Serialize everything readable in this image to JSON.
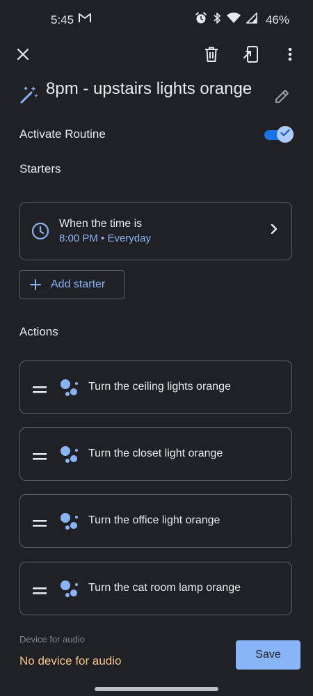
{
  "status_bar": {
    "time": "5:45",
    "battery": "46%",
    "icons": [
      "gmail-icon",
      "alarm-icon",
      "bluetooth-icon",
      "wifi-icon",
      "signal-icon"
    ]
  },
  "toolbar": {
    "icons": [
      "close-icon",
      "trash-icon",
      "duplicate-icon",
      "more-vert-icon"
    ]
  },
  "routine": {
    "title": "8pm - upstairs lights orange",
    "title_icon": "magic-wand-icon",
    "edit_icon": "pencil-icon",
    "activate_label": "Activate Routine",
    "activated": true
  },
  "starters": {
    "section_label": "Starters",
    "items": [
      {
        "title": "When the time is",
        "subtitle": "8:00 PM • Everyday",
        "icon": "clock-icon"
      }
    ],
    "add_label": "Add starter"
  },
  "actions": {
    "section_label": "Actions",
    "items": [
      {
        "label": "Turn the ceiling lights orange",
        "icon": "assistant-icon"
      },
      {
        "label": "Turn the closet light orange",
        "icon": "assistant-icon"
      },
      {
        "label": "Turn the office light orange",
        "icon": "assistant-icon"
      },
      {
        "label": "Turn the cat room lamp orange",
        "icon": "assistant-icon"
      }
    ]
  },
  "footer": {
    "audio_caption": "Device for audio",
    "audio_value": "No device for audio",
    "save_label": "Save"
  },
  "colors": {
    "background": "#202124",
    "accent": "#8ab4f8",
    "toggle_on": "#1a73e8",
    "audio_warning": "#f6c28b"
  }
}
